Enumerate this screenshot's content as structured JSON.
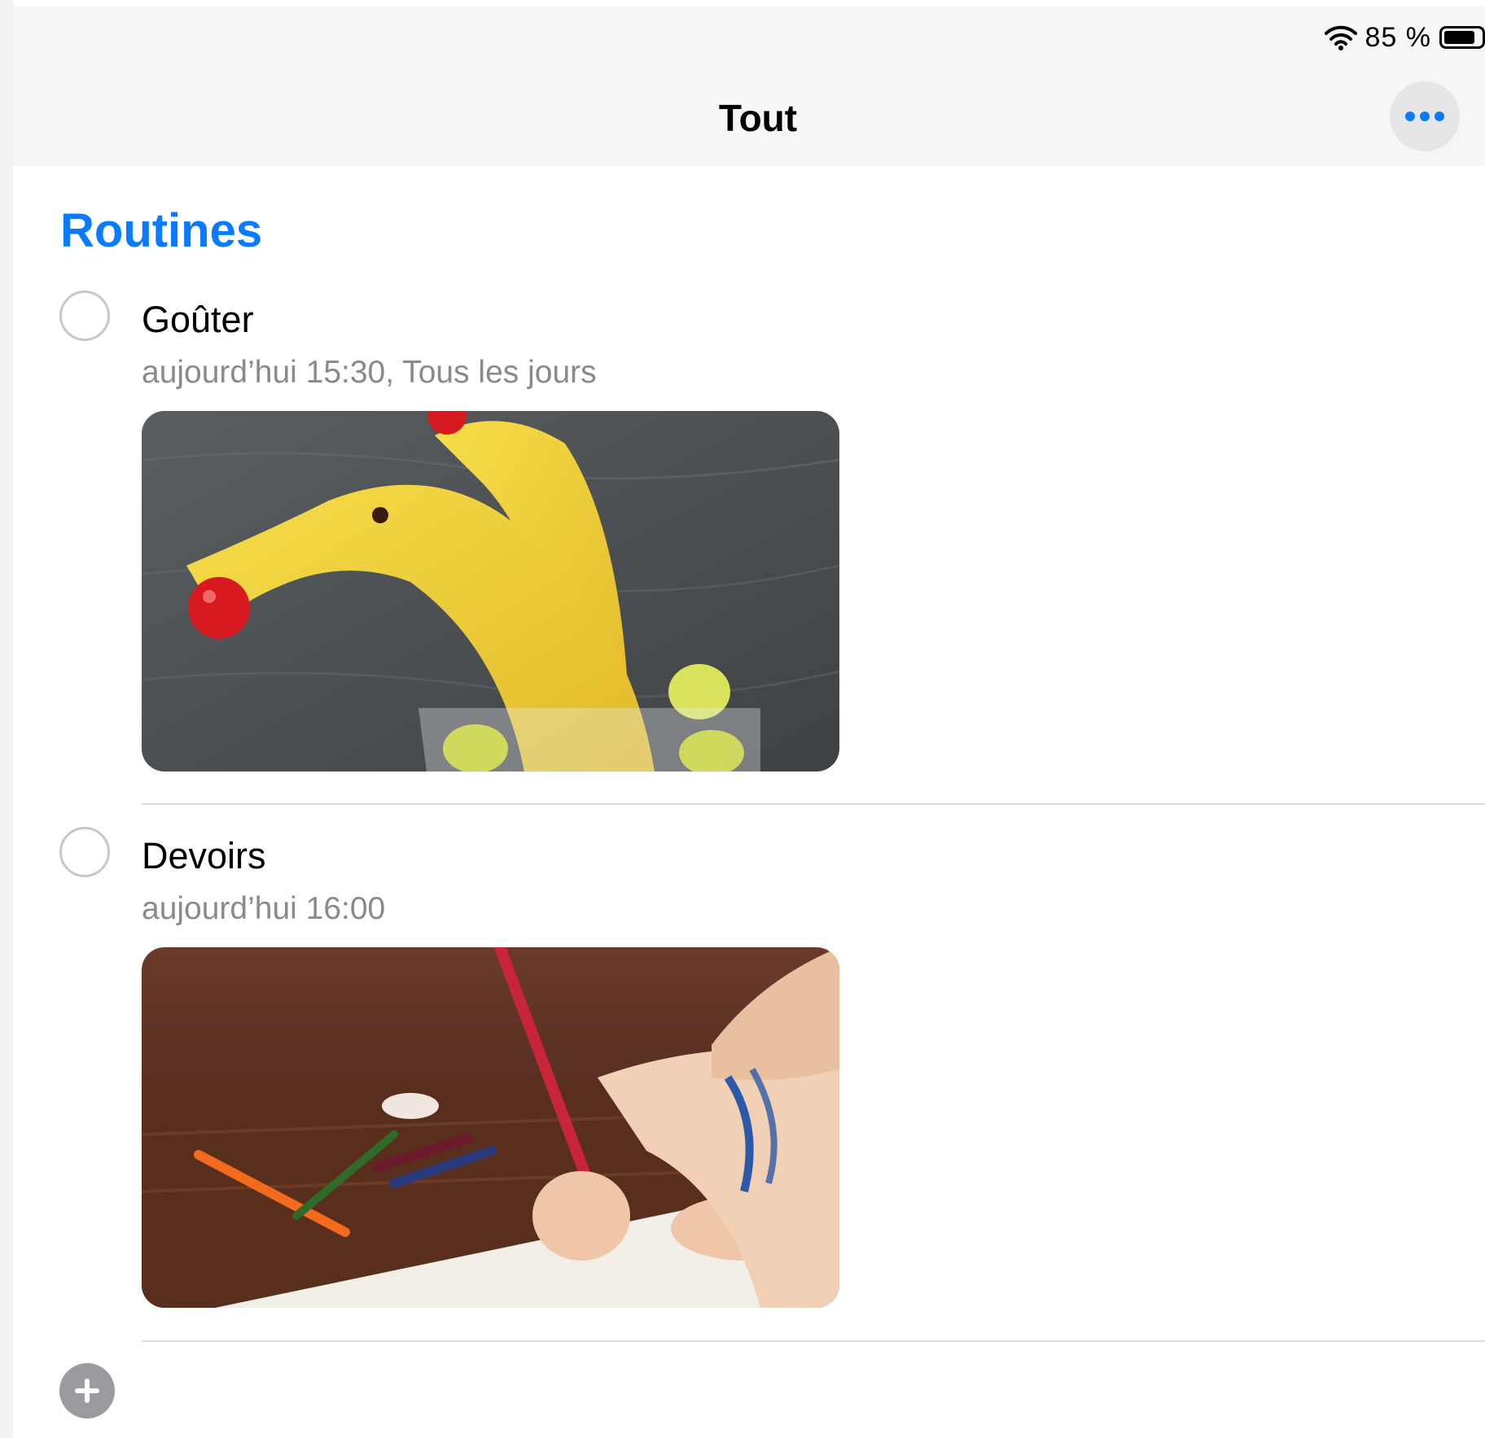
{
  "status_bar": {
    "battery_text": "85 %",
    "battery_level": 0.85
  },
  "header": {
    "title": "Tout",
    "more_icon": "ellipsis-icon"
  },
  "section": {
    "title": "Routines",
    "color": "#0a7bff"
  },
  "reminders": [
    {
      "title": "Goûter",
      "subtitle": "aujourd’hui 15:30, Tous les jours",
      "image": "banana-dolphin-snack-photo",
      "done": false
    },
    {
      "title": "Devoirs",
      "subtitle": "aujourd’hui 16:00",
      "image": "child-drawing-homework-photo",
      "done": false
    }
  ],
  "footer": {
    "add_icon": "plus-circle-icon"
  }
}
